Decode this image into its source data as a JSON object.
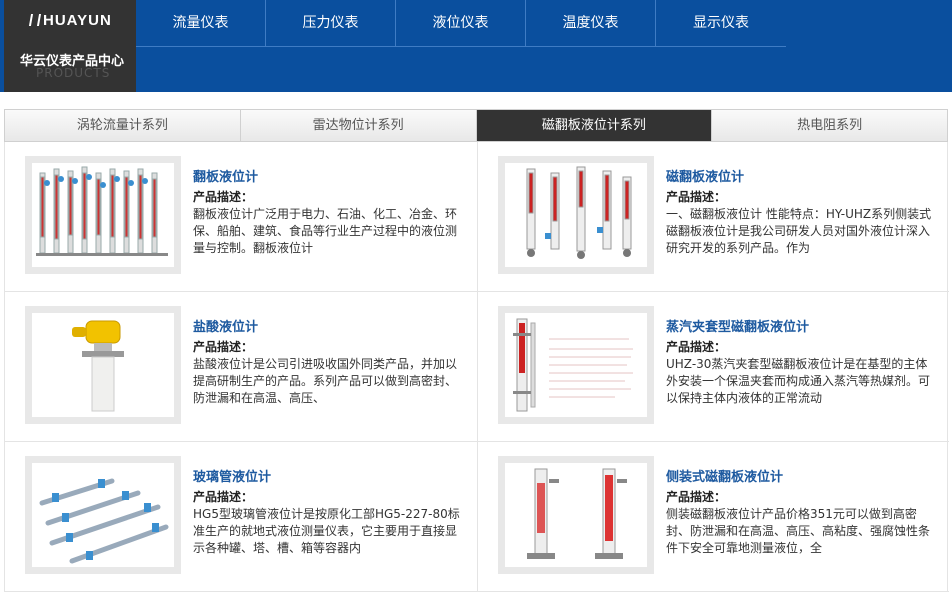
{
  "header": {
    "logo_text": "HUAYUN",
    "brand_cn": "华云仪表产品中心",
    "brand_en": "PRODUCTS",
    "nav": [
      "流量仪表",
      "压力仪表",
      "液位仪表",
      "温度仪表",
      "显示仪表"
    ]
  },
  "tabs": [
    {
      "label": "涡轮流量计系列",
      "active": false
    },
    {
      "label": "雷达物位计系列",
      "active": false
    },
    {
      "label": "磁翻板液位计系列",
      "active": true
    },
    {
      "label": "热电阻系列",
      "active": false
    }
  ],
  "products": [
    {
      "title": "翻板液位计",
      "label": "产品描述：",
      "desc": "翻板液位计广泛用于电力、石油、化工、冶金、环保、船舶、建筑、食品等行业生产过程中的液位测量与控制。翻板液位计"
    },
    {
      "title": "磁翻板液位计",
      "label": "产品描述：",
      "desc": "一、磁翻板液位计 性能特点：HY-UHZ系列侧装式磁翻板液位计是我公司研发人员对国外液位计深入研究开发的系列产品。作为"
    },
    {
      "title": "盐酸液位计",
      "label": "产品描述：",
      "desc": "盐酸液位计是公司引进吸收国外同类产品，并加以提高研制生产的产品。系列产品可以做到高密封、防泄漏和在高温、高压、"
    },
    {
      "title": "蒸汽夹套型磁翻板液位计",
      "label": "产品描述：",
      "desc": "UHZ-30蒸汽夹套型磁翻板液位计是在基型的主体外安装一个保温夹套而构成通入蒸汽等热媒剂。可以保持主体内液体的正常流动"
    },
    {
      "title": "玻璃管液位计",
      "label": "产品描述：",
      "desc": "HG5型玻璃管液位计是按原化工部HG5-227-80标准生产的就地式液位测量仪表，它主要用于直接显示各种罐、塔、槽、箱等容器内"
    },
    {
      "title": "侧装式磁翻板液位计",
      "label": "产品描述：",
      "desc": "侧装磁翻板液位计产品价格351元可以做到高密封、防泄漏和在高温、高压、高粘度、强腐蚀性条件下安全可靠地测量液位，全"
    }
  ],
  "colors": {
    "header_blue": "#0a4f9e",
    "title_blue": "#1e5aa0",
    "active_tab": "#333333"
  }
}
